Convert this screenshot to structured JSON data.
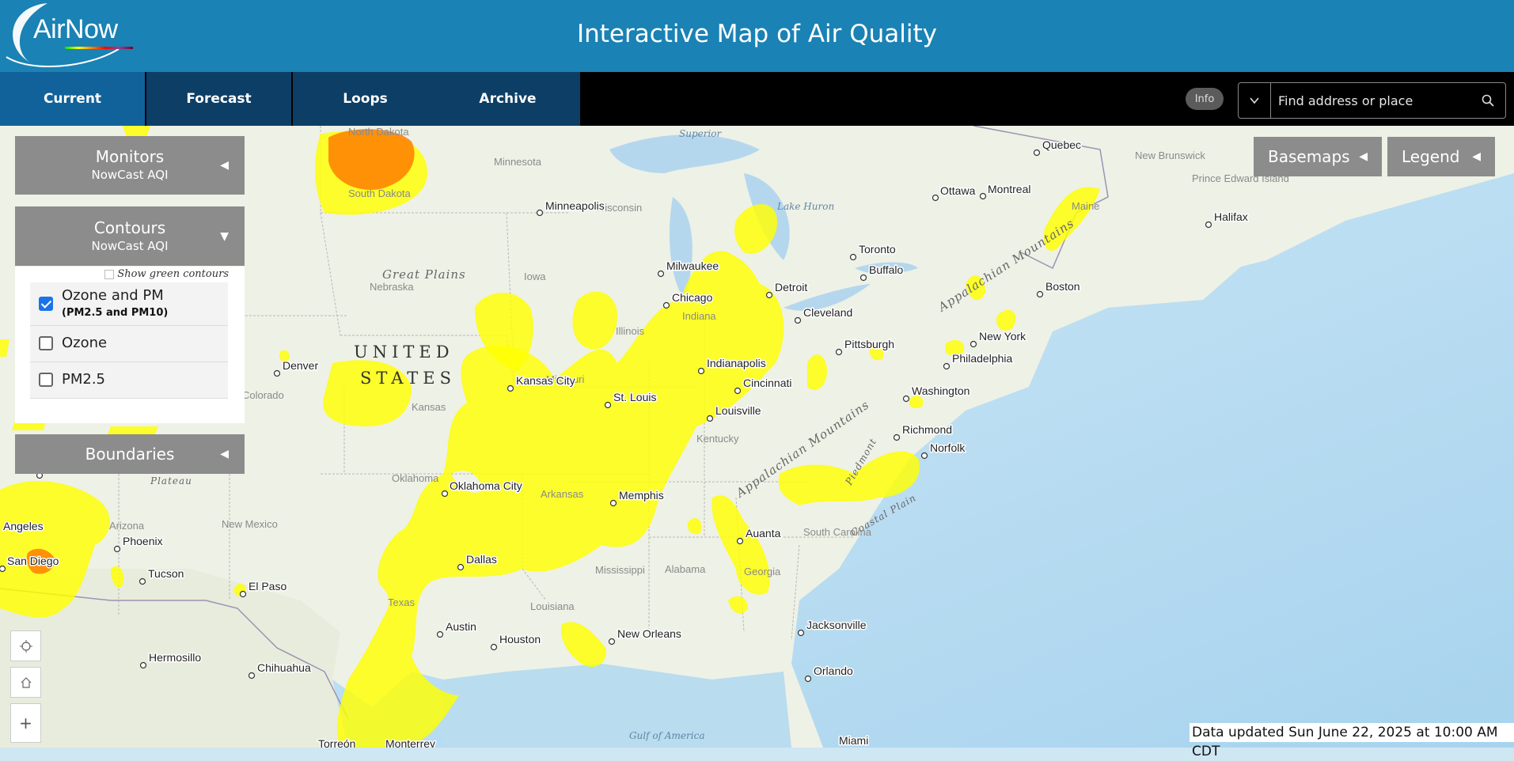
{
  "header": {
    "logo_text": "AirNow",
    "title": "Interactive Map of Air Quality"
  },
  "nav": {
    "tabs": [
      {
        "label": "Current",
        "active": true
      },
      {
        "label": "Forecast",
        "active": false
      },
      {
        "label": "Loops",
        "active": false
      },
      {
        "label": "Archive",
        "active": false
      }
    ],
    "info_label": "Info",
    "search_placeholder": "Find address or place"
  },
  "panels": {
    "monitors": {
      "title": "Monitors",
      "subtitle": "NowCast AQI"
    },
    "contours": {
      "title": "Contours",
      "subtitle": "NowCast AQI",
      "green_label": "Show green contours",
      "show_green": false,
      "options": [
        {
          "label": "Ozone and PM",
          "sublabel": "(PM2.5 and PM10)",
          "checked": true
        },
        {
          "label": "Ozone",
          "sublabel": "",
          "checked": false
        },
        {
          "label": "PM2.5",
          "sublabel": "",
          "checked": false
        }
      ]
    },
    "boundaries": {
      "title": "Boundaries"
    },
    "basemaps_label": "Basemaps",
    "legend_label": "Legend"
  },
  "map": {
    "colors": {
      "good": "#00e400",
      "moderate": "#ffff00",
      "usg": "#ff7e00",
      "unhealthy": "#ff0000"
    },
    "country_label": [
      "UNITED",
      "STATES"
    ],
    "regions": [
      "Great Plains",
      "Appalachian Mountains",
      "Appalachian Mountains",
      "Piedmont",
      "Coastal Plain",
      "Plateau"
    ],
    "waters": [
      "Superior",
      "Lake Huron",
      "Gulf of America"
    ],
    "states": [
      "North Dakota",
      "South Dakota",
      "Minnesota",
      "Wisconsin",
      "Nebraska",
      "Iowa",
      "Illinois",
      "Indiana",
      "Kansas",
      "Missouri",
      "Kentucky",
      "Oklahoma",
      "Arkansas",
      "Mississippi",
      "Alabama",
      "Georgia",
      "South Carolina",
      "Louisiana",
      "Texas",
      "New Mexico",
      "Arizona",
      "Colorado",
      "Maine",
      "New Brunswick",
      "Prince Edward Island"
    ],
    "cities": [
      "Quebec",
      "Ottawa",
      "Montreal",
      "Halifax",
      "Minneapolis",
      "Toronto",
      "Buffalo",
      "Milwaukee",
      "Detroit",
      "Boston",
      "Chicago",
      "Cleveland",
      "New York",
      "Pittsburgh",
      "Philadelphia",
      "Denver",
      "Indianapolis",
      "Kansas City",
      "Washington",
      "Cincinnati",
      "St. Louis",
      "Louisville",
      "Richmond",
      "Norfolk",
      "Oklahoma City",
      "Memphis",
      "Auanta",
      "Phoenix",
      "Angeles",
      "San Diego",
      "Tucson",
      "El Paso",
      "Dallas",
      "Austin",
      "Houston",
      "New Orleans",
      "Jacksonville",
      "Hermosillo",
      "Chihuahua",
      "Orlando",
      "Torreón",
      "Monterrey",
      "Miami"
    ]
  },
  "status": {
    "updated": "Data updated Sun June 22, 2025 at 10:00 AM CDT"
  }
}
